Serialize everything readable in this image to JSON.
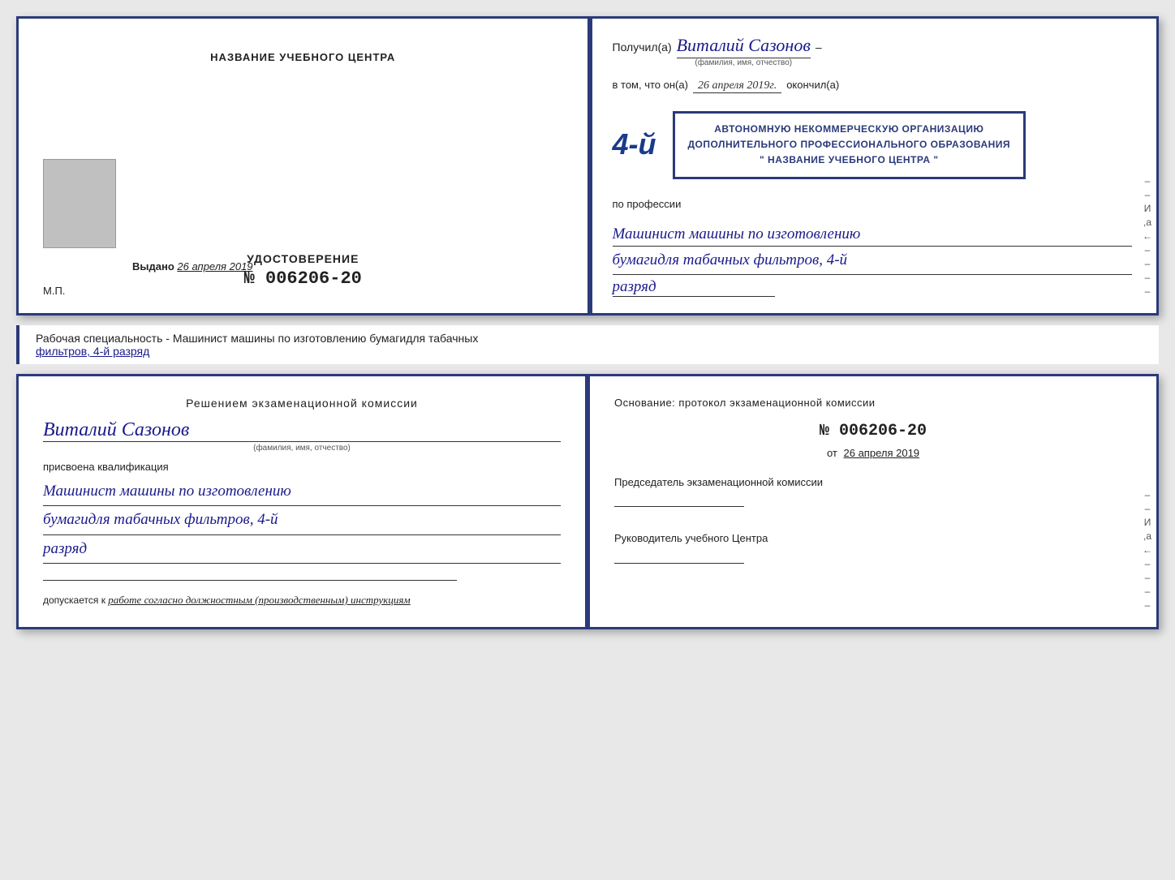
{
  "top_cert": {
    "left": {
      "title": "НАЗВАНИЕ УЧЕБНОГО ЦЕНТРА",
      "udostoverenie_label": "УДОСТОВЕРЕНИЕ",
      "number": "№ 006206-20",
      "issued_label": "Выдано",
      "issued_date": "26 апреля 2019",
      "mp": "М.П."
    },
    "right": {
      "poluchil_prefix": "Получил(а)",
      "recipient_name": "Виталий Сазонов",
      "recipient_sub": "(фамилия, имя, отчество)",
      "dash": "–",
      "vtom_prefix": "в том, что он(а)",
      "date_handwritten": "26 апреля 2019г.",
      "okonchil": "окончил(а)",
      "stamp_number": "4-й",
      "stamp_line1": "АВТОНОМНУЮ НЕКОММЕРЧЕСКУЮ ОРГАНИЗАЦИЮ",
      "stamp_line2": "ДОПОЛНИТЕЛЬНОГО ПРОФЕССИОНАЛЬНОГО ОБРАЗОВАНИЯ",
      "stamp_line3": "\" НАЗВАНИЕ УЧЕБНОГО ЦЕНТРА \"",
      "i_letter": "И",
      "a_letter": ",а",
      "arrow": "←",
      "po_professii": "по профессии",
      "profession_line1": "Машинист машины по изготовлению",
      "profession_line2": "бумагидля табачных фильтров, 4-й",
      "razryad": "разряд"
    }
  },
  "info_bar": {
    "text_prefix": "Рабочая специальность - Машинист машины по изготовлению бумагидля табачных",
    "text_underlined": "фильтров, 4-й разряд"
  },
  "bottom_cert": {
    "left": {
      "title": "Решением  экзаменационной  комиссии",
      "name_hw": "Виталий Сазонов",
      "name_sub": "(фамилия, имя, отчество)",
      "prisvoena": "присвоена квалификация",
      "profession_line1": "Машинист машины по изготовлению",
      "profession_line2": "бумагидля табачных фильтров, 4-й",
      "razryad": "разряд",
      "dopusk_prefix": "допускается к",
      "dopusk_text": "работе согласно должностным (производственным) инструкциям"
    },
    "right": {
      "osnov_label": "Основание: протокол экзаменационной  комиссии",
      "protocol_number": "№  006206-20",
      "ot_prefix": "от",
      "protocol_date": "26 апреля 2019",
      "predsedatel_label": "Председатель экзаменационной комиссии",
      "rukovoditel_label": "Руководитель учебного Центра",
      "i_letter": "И",
      "a_letter": ",а",
      "arrow": "←",
      "strips": [
        "–",
        "–",
        "–",
        "–",
        "–",
        "–"
      ]
    }
  }
}
